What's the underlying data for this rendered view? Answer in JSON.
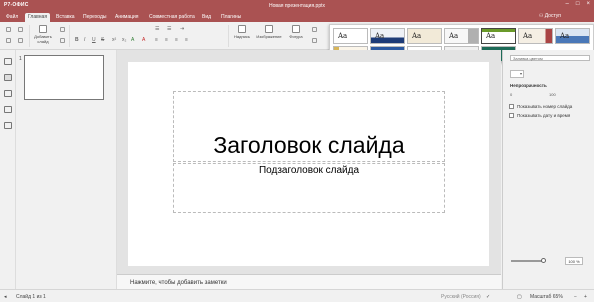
{
  "app": {
    "logo": "Р7-ОФИС",
    "doc_title": "Новая презентация.pptx",
    "user": "Доступ"
  },
  "tabs": [
    {
      "label": "Файл",
      "active": false
    },
    {
      "label": "Главная",
      "active": true
    },
    {
      "label": "Вставка",
      "active": false
    },
    {
      "label": "Переходы",
      "active": false
    },
    {
      "label": "Анимация",
      "active": false
    },
    {
      "label": "Совместная работа",
      "active": false
    },
    {
      "label": "Вид",
      "active": false
    },
    {
      "label": "Плагины",
      "active": false
    }
  ],
  "toolbar": {
    "add_slide": "Добавить слайд",
    "textbox": "Надпись",
    "image": "Изображение",
    "shape": "Фигура"
  },
  "thumbnails": {
    "number": "1"
  },
  "slide": {
    "title": "Заголовок слайда",
    "subtitle": "Подзаголовок слайда"
  },
  "notes": {
    "placeholder": "Нажмите, чтобы добавить заметки"
  },
  "right_panel": {
    "fill_select": "Заливка цветом",
    "opacity_label": "Непрозрачность",
    "slider_min": "0",
    "slider_max": "100",
    "opacity_value": "100 %",
    "show_slide_number": "Показывать номер слайда",
    "show_date": "Показывать дату и время"
  },
  "status": {
    "slide_of": "Слайд 1 из 1",
    "language": "Русский (Россия)",
    "zoom": "Масштаб 65%"
  },
  "themes": [
    {
      "label": "Aa",
      "bg": "#ffffff",
      "accent": "#ffffff",
      "selected": false
    },
    {
      "label": "Aa",
      "bg": "#eef1f6",
      "accent": "#1e3c78",
      "selected": false
    },
    {
      "label": "Aa",
      "bg": "#f2ead8",
      "accent": "#c9a86b",
      "selected": false
    },
    {
      "label": "Aa",
      "bg": "#f7f7f7",
      "accent": "#b0b0b0",
      "selected": false
    },
    {
      "label": "Aa",
      "bg": "#ffffff",
      "accent": "#6a9a2a",
      "selected": true
    },
    {
      "label": "Aa",
      "bg": "#f5efe4",
      "accent": "#a44",
      "selected": false
    },
    {
      "label": "Aa",
      "bg": "#dbe6f3",
      "accent": "#4a78b8",
      "selected": false
    },
    {
      "label": "Aa",
      "bg": "#fbf5e9",
      "accent": "#d8b65a",
      "selected": false
    },
    {
      "label": "Aa",
      "bg": "#2d5aa0",
      "accent": "#7fa7e0",
      "selected": false
    },
    {
      "label": "Aa",
      "bg": "#ffffff",
      "accent": "#e9e4d2",
      "selected": false
    },
    {
      "label": "Aa",
      "bg": "#f0f0f0",
      "accent": "#333333",
      "selected": false
    },
    {
      "label": "Aa",
      "bg": "#1e6b58",
      "accent": "#8fd0b0",
      "selected": false
    }
  ],
  "colors": {
    "brand": "#aa5252",
    "canvas": "#e3e3e3"
  }
}
